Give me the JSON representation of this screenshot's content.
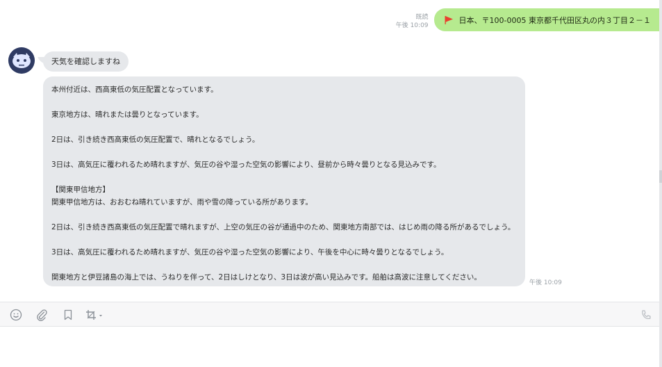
{
  "outgoing": {
    "read_label": "既読",
    "time": "午後 10:09",
    "text": "日本、〒100-0005 東京都千代田区丸の内３丁目２－１",
    "icon": "flag-icon",
    "bubble_color": "#b6ea8f",
    "flag_color": "#e8402f"
  },
  "incoming": {
    "short_message": "天気を確認しますね",
    "paragraphs": [
      "本州付近は、西高東低の気圧配置となっています。",
      "東京地方は、晴れまたは曇りとなっています。",
      "2日は、引き続き西高東低の気圧配置で、晴れとなるでしょう。",
      "3日は、高気圧に覆われるため晴れますが、気圧の谷や湿った空気の影響により、昼前から時々曇りとなる見込みです。",
      "【関東甲信地方】",
      "関東甲信地方は、おおむね晴れていますが、雨や雪の降っている所があります。",
      "2日は、引き続き西高東低の気圧配置で晴れますが、上空の気圧の谷が通過中のため、関東地方南部では、はじめ雨の降る所があるでしょう。",
      "3日は、高気圧に覆われるため晴れますが、気圧の谷や湿った空気の影響により、午後を中心に時々曇りとなるでしょう。",
      "関東地方と伊豆諸島の海上では、うねりを伴って、2日はしけとなり、3日は波が高い見込みです。船舶は高波に注意してください。"
    ],
    "time": "午後 10:09",
    "bubble_color": "#e6e8eb"
  },
  "toolbar": {
    "icons": [
      "emoji-icon",
      "attach-icon",
      "bookmark-icon",
      "crop-icon",
      "phone-icon"
    ]
  },
  "input": {
    "value": "",
    "placeholder": ""
  }
}
